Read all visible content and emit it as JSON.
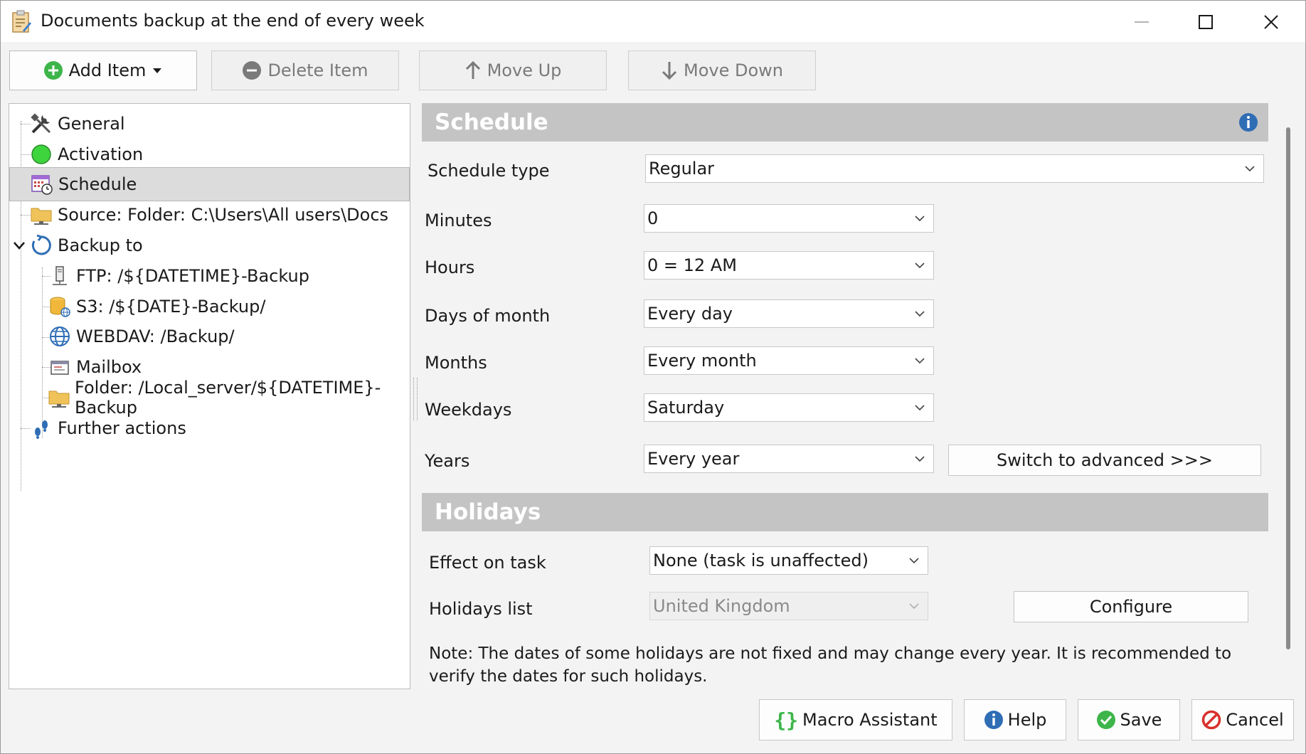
{
  "window": {
    "title": "Documents backup at the end of every week"
  },
  "toolbar": {
    "add_item": "Add Item",
    "delete_item": "Delete Item",
    "move_up": "Move Up",
    "move_down": "Move Down"
  },
  "tree": {
    "items": [
      {
        "label": "General"
      },
      {
        "label": "Activation"
      },
      {
        "label": "Schedule"
      },
      {
        "label": "Source: Folder: C:\\Users\\All users\\Docs"
      },
      {
        "label": "Backup to"
      },
      {
        "label": "FTP: /${DATETIME}-Backup"
      },
      {
        "label": "S3: /${DATE}-Backup/"
      },
      {
        "label": "WEBDAV: /Backup/"
      },
      {
        "label": "Mailbox"
      },
      {
        "label": "Folder: /Local_server/${DATETIME}-Backup"
      },
      {
        "label": "Further actions"
      }
    ]
  },
  "schedule": {
    "header": "Schedule",
    "schedule_type_label": "Schedule type",
    "schedule_type_value": "Regular",
    "minutes_label": "Minutes",
    "minutes_value": "0",
    "hours_label": "Hours",
    "hours_value": "0 = 12 AM",
    "days_label": "Days of month",
    "days_value": "Every day",
    "months_label": "Months",
    "months_value": "Every month",
    "weekdays_label": "Weekdays",
    "weekdays_value": "Saturday",
    "years_label": "Years",
    "years_value": "Every year",
    "switch_advanced": "Switch to advanced >>>"
  },
  "holidays": {
    "header": "Holidays",
    "effect_label": "Effect on task",
    "effect_value": "None (task is unaffected)",
    "list_label": "Holidays list",
    "list_value": "United Kingdom",
    "configure": "Configure",
    "note": "Note: The dates of some holidays are not fixed and may change every year. It is recommended to verify the dates for such holidays."
  },
  "footer": {
    "macro": "Macro Assistant",
    "help": "Help",
    "save": "Save",
    "cancel": "Cancel"
  },
  "colors": {
    "header_bg": "#c4c4c4",
    "add_green": "#3db54a",
    "info_blue": "#2f6db5",
    "cancel_red": "#d9302c",
    "activation_green": "#3ed43e"
  }
}
